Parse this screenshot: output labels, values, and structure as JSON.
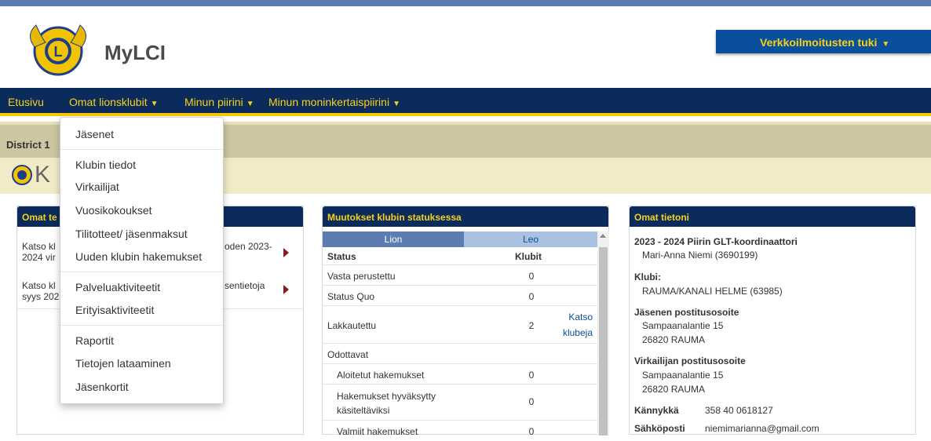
{
  "header": {
    "brand": "MyLCI",
    "support_label": "Verkkoilmoitusten tuki"
  },
  "nav": [
    {
      "label": "Etusivu"
    },
    {
      "label": "Omat lionsklubit"
    },
    {
      "label": "Minun piirini"
    },
    {
      "label": "Minun moninkertaispiirini"
    }
  ],
  "district": {
    "text": "District 1"
  },
  "page": {
    "title": "K"
  },
  "dropdown": {
    "items": [
      "Jäsenet",
      "Klubin tiedot",
      "Virkailijat",
      "Vuosikokoukset",
      "Tilitotteet/ jäsenmaksut",
      "Uuden klubin hakemukset",
      "Palveluaktiviteetit",
      "Erityisaktiviteetit",
      "Raportit",
      "Tietojen lataaminen",
      "Jäsenkortit"
    ]
  },
  "panel1": {
    "title": "Omat te",
    "rows": [
      {
        "left": "Katso kl",
        "left2": "2024 vir",
        "right": "oden 2023-"
      },
      {
        "left": "Katso kl",
        "left2": "syys 202",
        "right": "sentietoja"
      }
    ]
  },
  "panel2": {
    "title": "Muutokset klubin statuksessa",
    "tabs": [
      "Lion",
      "Leo"
    ],
    "header": {
      "status": "Status",
      "clubs": "Klubit"
    },
    "rows": [
      {
        "label": "Vasta perustettu",
        "value": "0",
        "link": ""
      },
      {
        "label": "Status Quo",
        "value": "0",
        "link": ""
      },
      {
        "label": "Lakkautettu",
        "value": "2",
        "link": "Katso klubeja"
      },
      {
        "label": "Odottavat",
        "value": "",
        "link": ""
      },
      {
        "label": "Aloitetut hakemukset",
        "value": "0",
        "link": ""
      },
      {
        "label": "Hakemukset hyväksytty käsiteltäviksi",
        "value": "0",
        "link": ""
      },
      {
        "label": "Valmiit hakemukset",
        "value": "0",
        "link": ""
      }
    ]
  },
  "panel3": {
    "title": "Omat tietoni",
    "role": "2023 - 2024 Piirin GLT-koordinaattori",
    "name": "Mari-Anna Niemi (3690199)",
    "club_label": "Klubi:",
    "club": "RAUMA/KANALI HELME (63985)",
    "member_addr_label": "Jäsenen postitusosoite",
    "member_addr1": "Sampaanalantie 15",
    "member_addr2": "26820 RAUMA",
    "officer_addr_label": "Virkailijan postitusosoite",
    "officer_addr1": "Sampaanalantie 15",
    "officer_addr2": "26820 RAUMA",
    "phone_label": "Kännykkä",
    "phone": "358 40 0618127",
    "email_label": "Sähköposti",
    "email": "niemimarianna@gmail.com"
  }
}
